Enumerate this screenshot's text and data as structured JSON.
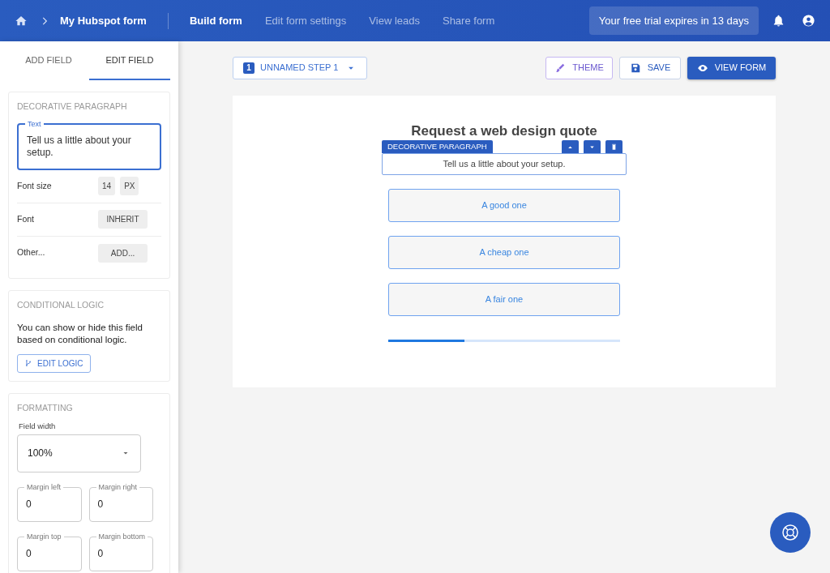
{
  "header": {
    "breadcrumb": "My Hubspot form",
    "nav": [
      {
        "label": "Build form",
        "selected": true
      },
      {
        "label": "Edit form settings",
        "selected": false
      },
      {
        "label": "View leads",
        "selected": false
      },
      {
        "label": "Share form",
        "selected": false
      }
    ],
    "trial_notice": "Your free trial expires in 13 days"
  },
  "sidebar": {
    "tabs": [
      {
        "label": "ADD FIELD",
        "selected": false
      },
      {
        "label": "EDIT FIELD",
        "selected": true
      }
    ],
    "paragraph_panel": {
      "title": "DECORATIVE PARAGRAPH",
      "text_field": {
        "label": "Text",
        "value": "Tell us a little about your setup."
      },
      "rows": [
        {
          "label": "Font size",
          "values": [
            "14",
            "PX"
          ]
        },
        {
          "label": "Font",
          "values": [
            "INHERIT"
          ]
        },
        {
          "label": "Other...",
          "values": [
            "ADD..."
          ]
        }
      ]
    },
    "conditional_logic": {
      "title": "CONDITIONAL LOGIC",
      "description": "You can show or hide this field based on conditional logic.",
      "button": "EDIT LOGIC"
    },
    "formatting": {
      "title": "FORMATTING",
      "field_width": {
        "label": "Field width",
        "value": "100%"
      },
      "margins": [
        {
          "label": "Margin left",
          "value": "0"
        },
        {
          "label": "Margin right",
          "value": "0"
        },
        {
          "label": "Margin top",
          "value": "0"
        },
        {
          "label": "Margin bottom",
          "value": "0"
        }
      ]
    }
  },
  "canvas": {
    "step": {
      "number": "1",
      "label": "UNNAMED STEP 1"
    },
    "buttons": [
      {
        "label": "THEME",
        "kind": "theme"
      },
      {
        "label": "SAVE",
        "kind": "save"
      },
      {
        "label": "VIEW FORM",
        "kind": "view"
      }
    ],
    "form": {
      "heading": "Request a web design quote",
      "toolbar_label": "DECORATIVE PARAGRAPH",
      "paragraph": "Tell us a little about your setup.",
      "options": [
        "A good one",
        "A cheap one",
        "A fair one"
      ],
      "progress": {
        "level": 0.33
      }
    }
  }
}
